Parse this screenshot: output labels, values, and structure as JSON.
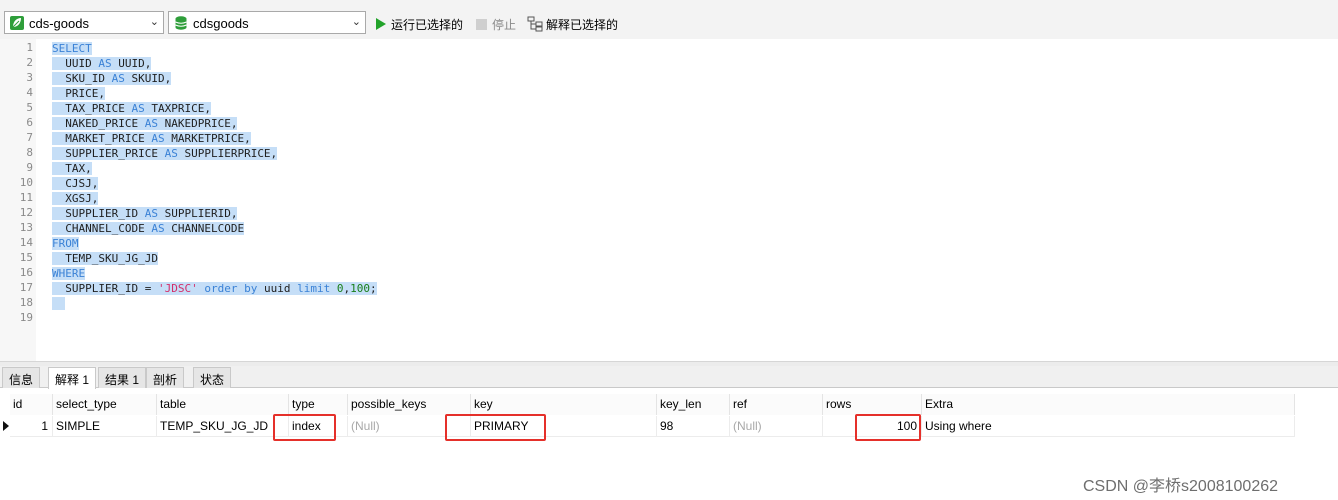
{
  "toolbar": {
    "connection": {
      "value": "cds-goods",
      "icon": "connection-leaf-icon"
    },
    "database": {
      "value": "cdsgoods",
      "icon": "database-icon"
    },
    "run_selected_label": "运行已选择的",
    "stop_label": "停止",
    "explain_selected_label": "解释已选择的"
  },
  "editor": {
    "line_numbers": [
      "1",
      "2",
      "3",
      "4",
      "5",
      "6",
      "7",
      "8",
      "9",
      "10",
      "11",
      "12",
      "13",
      "14",
      "15",
      "16",
      "17",
      "18",
      "19"
    ],
    "lines": [
      [
        {
          "t": "SELECT",
          "c": "kw"
        }
      ],
      [
        {
          "t": "  UUID ",
          "c": "plain"
        },
        {
          "t": "AS",
          "c": "kw"
        },
        {
          "t": " UUID,",
          "c": "plain"
        }
      ],
      [
        {
          "t": "  SKU_ID ",
          "c": "plain"
        },
        {
          "t": "AS",
          "c": "kw"
        },
        {
          "t": " SKUID,",
          "c": "plain"
        }
      ],
      [
        {
          "t": "  PRICE,",
          "c": "plain"
        }
      ],
      [
        {
          "t": "  TAX_PRICE ",
          "c": "plain"
        },
        {
          "t": "AS",
          "c": "kw"
        },
        {
          "t": " TAXPRICE,",
          "c": "plain"
        }
      ],
      [
        {
          "t": "  NAKED_PRICE ",
          "c": "plain"
        },
        {
          "t": "AS",
          "c": "kw"
        },
        {
          "t": " NAKEDPRICE,",
          "c": "plain"
        }
      ],
      [
        {
          "t": "  MARKET_PRICE ",
          "c": "plain"
        },
        {
          "t": "AS",
          "c": "kw"
        },
        {
          "t": " MARKETPRICE,",
          "c": "plain"
        }
      ],
      [
        {
          "t": "  SUPPLIER_PRICE ",
          "c": "plain"
        },
        {
          "t": "AS",
          "c": "kw"
        },
        {
          "t": " SUPPLIERPRICE,",
          "c": "plain"
        }
      ],
      [
        {
          "t": "  TAX,",
          "c": "plain"
        }
      ],
      [
        {
          "t": "  CJSJ,",
          "c": "plain"
        }
      ],
      [
        {
          "t": "  XGSJ,",
          "c": "plain"
        }
      ],
      [
        {
          "t": "  SUPPLIER_ID ",
          "c": "plain"
        },
        {
          "t": "AS",
          "c": "kw"
        },
        {
          "t": " SUPPLIERID,",
          "c": "plain"
        }
      ],
      [
        {
          "t": "  CHANNEL_CODE ",
          "c": "plain"
        },
        {
          "t": "AS",
          "c": "kw"
        },
        {
          "t": " CHANNELCODE",
          "c": "plain"
        }
      ],
      [
        {
          "t": "FROM",
          "c": "kw"
        }
      ],
      [
        {
          "t": "  TEMP_SKU_JG_JD",
          "c": "plain"
        }
      ],
      [
        {
          "t": "WHERE",
          "c": "kw"
        }
      ],
      [
        {
          "t": "  SUPPLIER_ID = ",
          "c": "plain"
        },
        {
          "t": "'JDSC'",
          "c": "str"
        },
        {
          "t": " ",
          "c": "plain"
        },
        {
          "t": "order by",
          "c": "kw"
        },
        {
          "t": " uuid ",
          "c": "plain"
        },
        {
          "t": "limit",
          "c": "kw"
        },
        {
          "t": " ",
          "c": "plain"
        },
        {
          "t": "0",
          "c": "num"
        },
        {
          "t": ",",
          "c": "plain"
        },
        {
          "t": "100",
          "c": "num"
        },
        {
          "t": ";",
          "c": "plain"
        }
      ],
      [
        {
          "t": "  ",
          "c": "plain"
        }
      ],
      []
    ]
  },
  "tabs": [
    {
      "label": "信息",
      "active": false
    },
    {
      "label": "解释 1",
      "active": true
    },
    {
      "label": "结果 1",
      "active": false
    },
    {
      "label": "剖析",
      "active": false
    },
    {
      "label": "状态",
      "active": false
    }
  ],
  "explain_grid": {
    "columns": [
      "id",
      "select_type",
      "table",
      "type",
      "possible_keys",
      "key",
      "key_len",
      "ref",
      "rows",
      "Extra"
    ],
    "row": {
      "id": "1",
      "select_type": "SIMPLE",
      "table": "TEMP_SKU_JG_JD",
      "type": "index",
      "possible_keys": "(Null)",
      "key": "PRIMARY",
      "key_len": "98",
      "ref": "(Null)",
      "rows": "100",
      "Extra": "Using where"
    },
    "highlight_color": "#e5302a"
  },
  "watermark": "CSDN @李桥s2008100262",
  "colors": {
    "selection": "#c5def7",
    "keyword": "#3b82d6",
    "string": "#d32f6a",
    "number": "#1a7f1a",
    "run": "#22a32a"
  }
}
